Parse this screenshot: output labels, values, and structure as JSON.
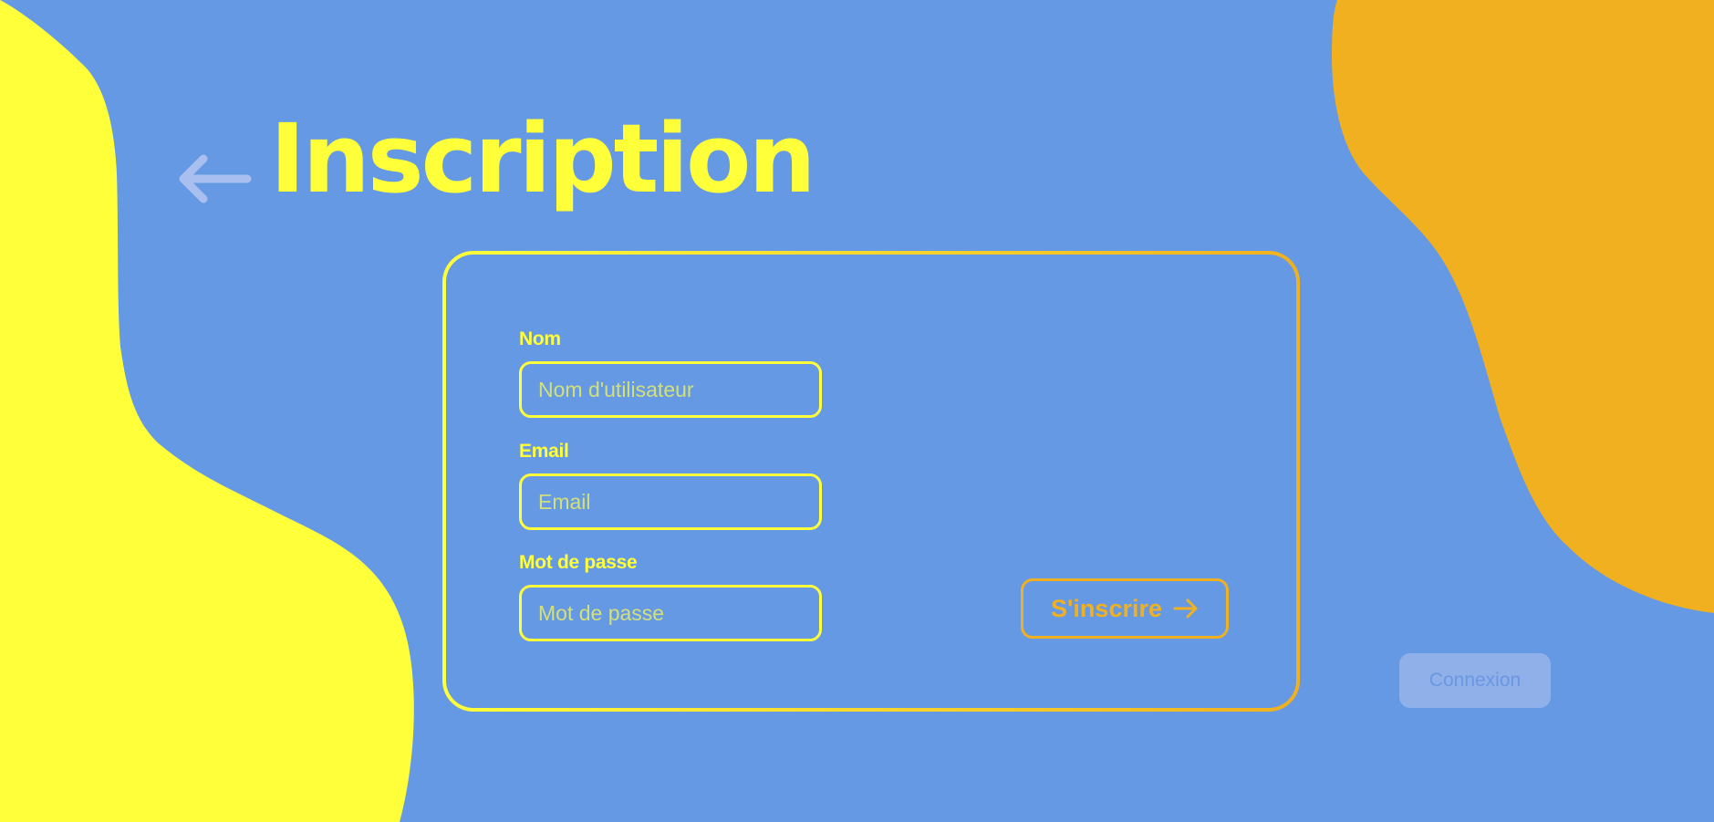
{
  "colors": {
    "background": "#6699e3",
    "accent_yellow": "#ffff3a",
    "accent_orange": "#f0b020",
    "muted_button_bg": "#8fb0e9",
    "muted_button_text": "#6b97e2"
  },
  "header": {
    "back_icon": "arrow-left-icon",
    "title": "Inscription"
  },
  "form": {
    "fields": [
      {
        "label": "Nom",
        "placeholder": "Nom d'utilisateur",
        "value": ""
      },
      {
        "label": "Email",
        "placeholder": "Email",
        "value": ""
      },
      {
        "label": "Mot de passe",
        "placeholder": "Mot de passe",
        "value": ""
      }
    ],
    "submit": {
      "label": "S'inscrire",
      "icon": "arrow-right-icon"
    }
  },
  "login_button": {
    "label": "Connexion"
  }
}
